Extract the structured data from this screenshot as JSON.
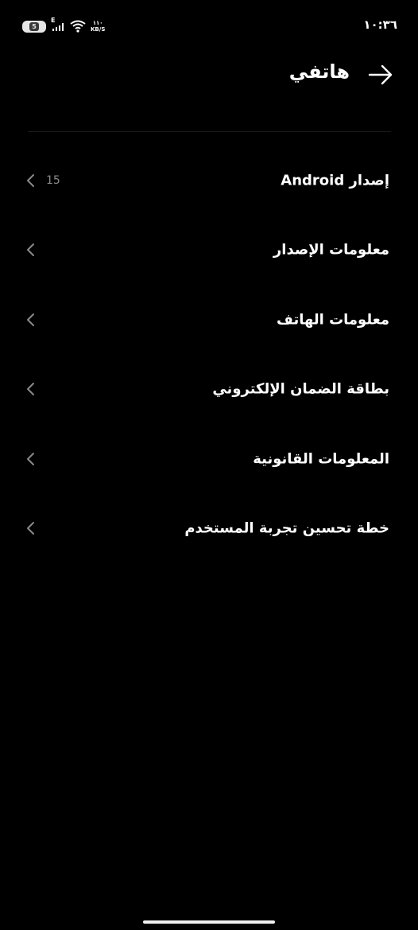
{
  "status_bar": {
    "time": "١٠:٣٦",
    "battery_level": "5",
    "network_type": "E",
    "speed_value": "١١٠",
    "speed_unit": "KB/S"
  },
  "header": {
    "title": "هاتفي",
    "back_icon": "arrow-right-icon"
  },
  "items": [
    {
      "label": "إصدار Android",
      "value": "15"
    },
    {
      "label": "معلومات الإصدار",
      "value": ""
    },
    {
      "label": "معلومات الهاتف",
      "value": ""
    },
    {
      "label": "بطاقة الضمان الإلكتروني",
      "value": ""
    },
    {
      "label": "المعلومات القانونية",
      "value": ""
    },
    {
      "label": "خطة تحسين تجربة المستخدم",
      "value": ""
    }
  ],
  "colors": {
    "background": "#000000",
    "text": "#ffffff",
    "secondary_text": "#8a8a8a",
    "chevron": "#8a8a8a"
  }
}
